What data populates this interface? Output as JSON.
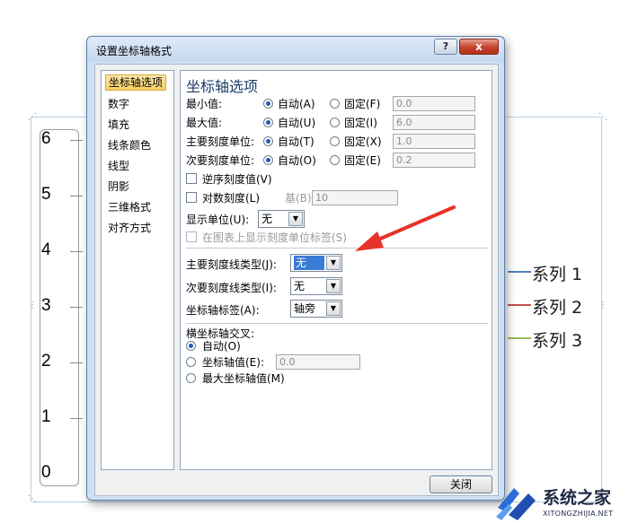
{
  "chart": {
    "y_ticks": [
      "6",
      "5",
      "4",
      "3",
      "2",
      "1",
      "0"
    ],
    "legend": [
      {
        "label": "系列 1",
        "color": "#4f81bd"
      },
      {
        "label": "系列 2",
        "color": "#c0504d"
      },
      {
        "label": "系列 3",
        "color": "#9bbb59"
      }
    ]
  },
  "dialog": {
    "title": "设置坐标轴格式",
    "help_label": "?",
    "close_x_label": "x",
    "categories": [
      "坐标轴选项",
      "数字",
      "填充",
      "线条颜色",
      "线型",
      "阴影",
      "三维格式",
      "对齐方式"
    ],
    "selected_category": "坐标轴选项",
    "section_title": "坐标轴选项",
    "min": {
      "label": "最小值:",
      "auto": "自动(A)",
      "fixed": "固定(F)",
      "value": "0.0"
    },
    "max": {
      "label": "最大值:",
      "auto": "自动(U)",
      "fixed": "固定(I)",
      "value": "6.0"
    },
    "major_unit": {
      "label": "主要刻度单位:",
      "auto": "自动(T)",
      "fixed": "固定(X)",
      "value": "1.0"
    },
    "minor_unit": {
      "label": "次要刻度单位:",
      "auto": "自动(O)",
      "fixed": "固定(E)",
      "value": "0.2"
    },
    "reverse_order": "逆序刻度值(V)",
    "log_scale": "对数刻度(L)",
    "log_base_label": "基(B):",
    "log_base_value": "10",
    "display_units_label": "显示单位(U):",
    "display_units_value": "无",
    "show_units_label": "在图表上显示刻度单位标签(S)",
    "major_tick_label": "主要刻度线类型(J):",
    "major_tick_value": "无",
    "minor_tick_label": "次要刻度线类型(I):",
    "minor_tick_value": "无",
    "axis_labels_label": "坐标轴标签(A):",
    "axis_labels_value": "轴旁",
    "cross_title": "横坐标轴交叉:",
    "cross_auto": "自动(O)",
    "cross_value_label": "坐标轴值(E):",
    "cross_value": "0.0",
    "cross_max": "最大坐标轴值(M)",
    "close_button": "关闭"
  },
  "watermark": {
    "name": "系统之家",
    "url": "XITONGZHIJIA.NET"
  }
}
